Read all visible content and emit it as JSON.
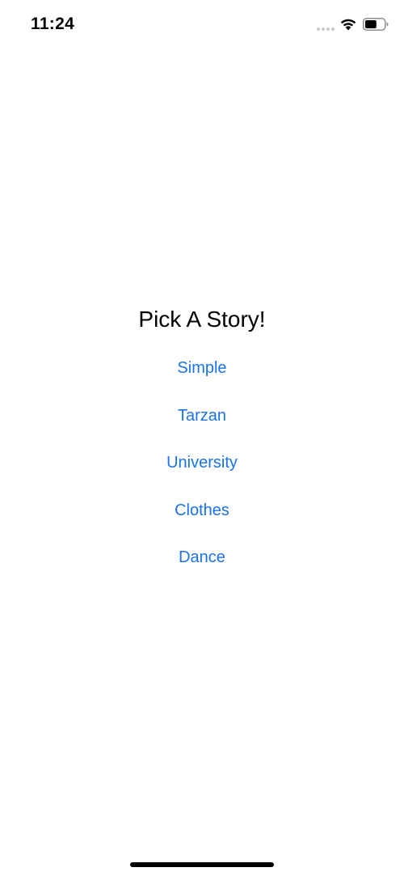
{
  "status_bar": {
    "time": "11:24",
    "icons": [
      "signal-dots-icon",
      "wifi-icon",
      "battery-icon"
    ],
    "battery_level": 0.6
  },
  "main": {
    "title": "Pick A Story!",
    "stories": [
      {
        "label": "Simple"
      },
      {
        "label": "Tarzan"
      },
      {
        "label": "University"
      },
      {
        "label": "Clothes"
      },
      {
        "label": "Dance"
      }
    ]
  },
  "colors": {
    "accent": "#1a73e8",
    "text": "#000000",
    "background": "#ffffff"
  }
}
